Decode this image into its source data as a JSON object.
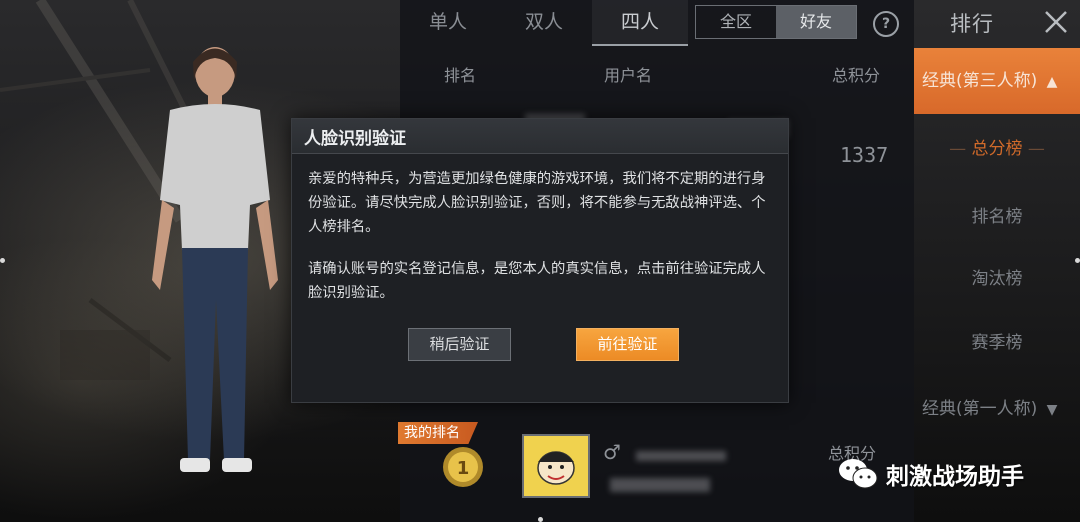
{
  "tabs": [
    "单人",
    "双人",
    "四人"
  ],
  "active_tab": "四人",
  "scope": {
    "all": "全区",
    "friends": "好友",
    "active": "好友"
  },
  "help_glyph": "?",
  "header_title": "排行",
  "columns": {
    "rank": "排名",
    "username": "用户名",
    "score": "总积分"
  },
  "visible_score": "1337",
  "side_menu": {
    "mode_selected": "经典(第三人称)",
    "items": [
      "总分榜",
      "排名榜",
      "淘汰榜",
      "赛季榜"
    ],
    "active_item": "总分榜",
    "footer_mode": "经典(第一人称)"
  },
  "my_rank": {
    "badge": "我的排名",
    "score_label": "总积分",
    "gender": "♂"
  },
  "modal": {
    "title": "人脸识别验证",
    "paragraph1": "亲爱的特种兵，为营造更加绿色健康的游戏环境，我们将不定期的进行身份验证。请尽快完成人脸识别验证，否则，将不能参与无敌战神评选、个人榜排名。",
    "paragraph2": "请确认账号的实名登记信息，是您本人的真实信息，点击前往验证完成人脸识别验证。",
    "later_button": "稍后验证",
    "go_button": "前往验证"
  },
  "watermark": "刺激战场助手",
  "colors": {
    "accent": "#ec8b25",
    "panel": "#1e2024",
    "side_head": "#e9823a"
  },
  "icons": [
    "help-icon",
    "close-icon",
    "medal-icon",
    "avatar-icon",
    "gender-male-icon",
    "wechat-icon",
    "triangle-up-icon",
    "triangle-down-icon"
  ]
}
